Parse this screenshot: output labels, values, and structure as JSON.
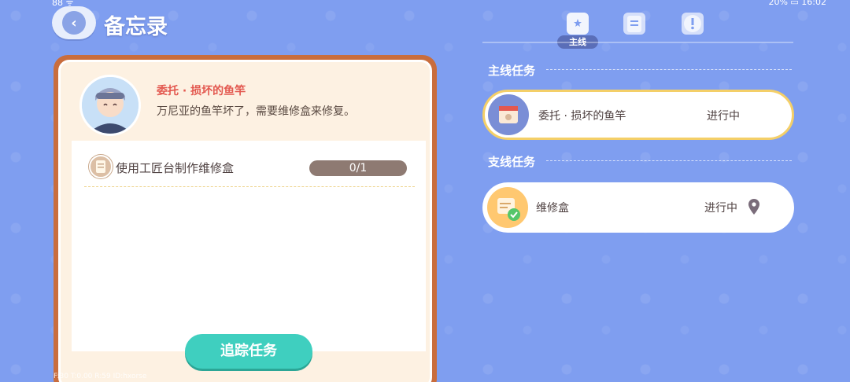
{
  "header": {
    "title": "备忘录"
  },
  "tabs": {
    "active_label": "主线",
    "icons": [
      "quest-book-icon",
      "clipboard-icon",
      "badge-icon"
    ]
  },
  "status_bar": {
    "left": "88 ᯤ",
    "right": "20% ▭ 16:02"
  },
  "detail": {
    "title": "委托 · 损坏的鱼竿",
    "description": "万尼亚的鱼竿坏了，需要维修盒来修复。",
    "task": {
      "label": "使用工匠台制作维修盒",
      "progress": "0/1"
    },
    "track_button": "追踪任务"
  },
  "sections": {
    "main": {
      "header": "主线任务",
      "quest": {
        "name": "委托 · 损坏的鱼竿",
        "status": "进行中"
      }
    },
    "side": {
      "header": "支线任务",
      "quest": {
        "name": "维修盒",
        "status": "进行中"
      }
    }
  },
  "debug": "F:30  T:0.00  R:59  ID:hxorse",
  "colors": {
    "background": "#7f9ef0",
    "accent_red": "#e3584f",
    "track_green": "#3fcfbf",
    "active_border": "#f4cf68"
  }
}
